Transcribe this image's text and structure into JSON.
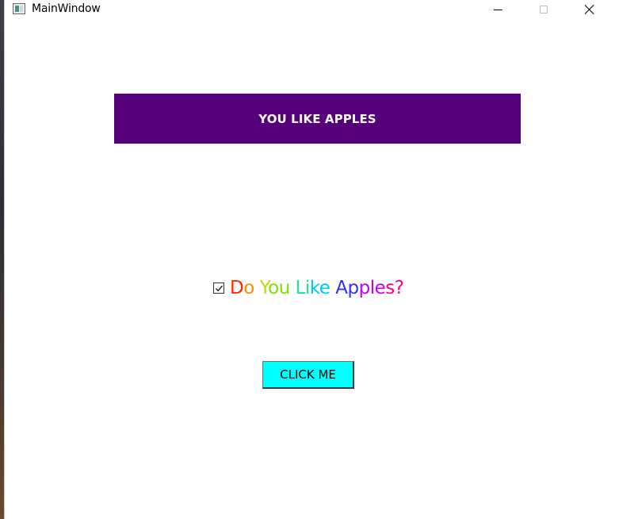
{
  "window": {
    "title": "MainWindow",
    "icon": "app-window-icon",
    "controls": {
      "minimize_icon": "minimize-icon",
      "maximize_icon": "maximize-icon",
      "close_icon": "close-icon"
    }
  },
  "banner": {
    "text": "YOU LIKE APPLES",
    "background": "#56007c",
    "color": "#ffffff"
  },
  "checkbox": {
    "checked": true,
    "label_words": [
      {
        "text": "Do",
        "colors": [
          "#ff2a00",
          "#ff8a00"
        ]
      },
      {
        "text": "You",
        "colors": [
          "#b8e000",
          "#7ce000"
        ]
      },
      {
        "text": "Like",
        "colors": [
          "#20e0a0",
          "#00c8f0"
        ]
      },
      {
        "text": "Apples?",
        "colors": [
          "#3030ff",
          "#c000ff",
          "#ff0080"
        ]
      }
    ]
  },
  "button": {
    "label": "CLICK ME",
    "background": "#00ffff"
  }
}
